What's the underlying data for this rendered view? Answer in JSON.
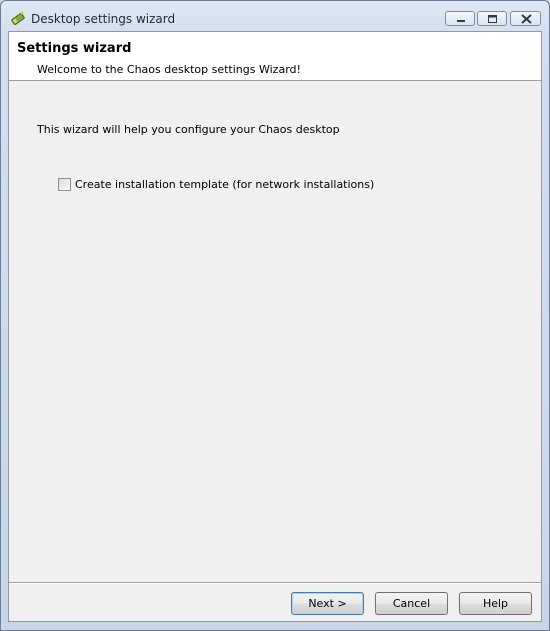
{
  "window": {
    "title": "Desktop settings wizard",
    "icon": "wizard-wand-icon",
    "controls": {
      "minimize": "minimize-icon",
      "maximize": "maximize-icon",
      "close": "close-icon"
    }
  },
  "header": {
    "title": "Settings wizard",
    "subtitle": "Welcome to the Chaos desktop settings Wizard!"
  },
  "body": {
    "intro": "This wizard will help you configure your Chaos desktop",
    "checkbox": {
      "label": "Create installation template (for network installations)",
      "checked": false
    }
  },
  "footer": {
    "next_label": "Next >",
    "cancel_label": "Cancel",
    "help_label": "Help"
  },
  "colors": {
    "frame": "#c9d6e5",
    "client_bg": "#f0f0f0",
    "header_bg": "#ffffff",
    "default_button_border": "#3c7fb1"
  }
}
